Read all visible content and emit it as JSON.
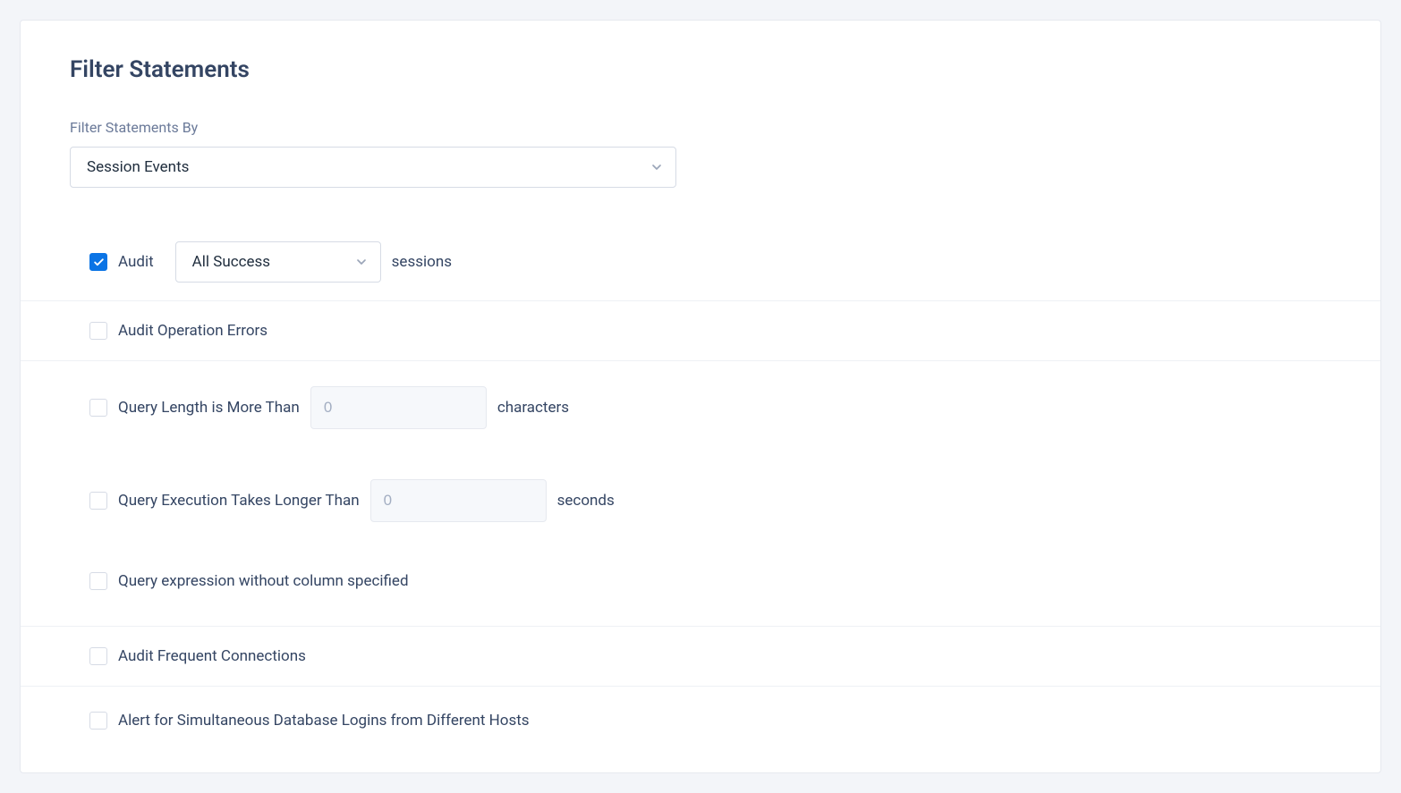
{
  "title": "Filter Statements",
  "filterByLabel": "Filter Statements By",
  "filterBySelect": "Session Events",
  "rows": {
    "audit": {
      "label": "Audit",
      "select": "All Success",
      "suffix": "sessions"
    },
    "auditErrors": {
      "label": "Audit Operation Errors"
    },
    "queryLength": {
      "label": "Query Length is More Than",
      "placeholder": "0",
      "suffix": "characters"
    },
    "queryExec": {
      "label": "Query Execution Takes Longer Than",
      "placeholder": "0",
      "suffix": "seconds"
    },
    "queryExpr": {
      "label": "Query expression without column specified"
    },
    "freqConn": {
      "label": "Audit Frequent Connections"
    },
    "simLogins": {
      "label": "Alert for Simultaneous Database Logins from Different Hosts"
    }
  }
}
